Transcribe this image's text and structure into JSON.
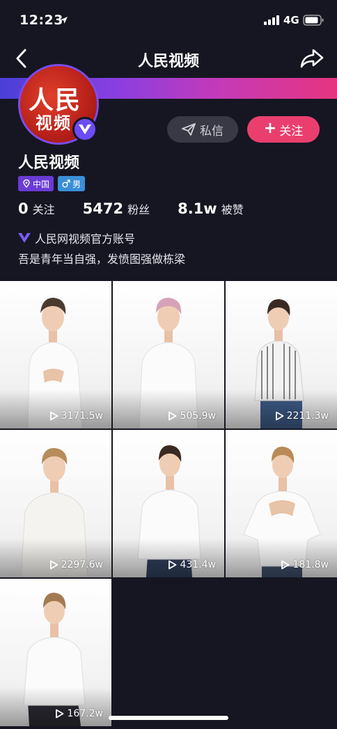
{
  "status_bar": {
    "time": "12:23",
    "network": "4G"
  },
  "nav": {
    "title": "人民视频",
    "back_icon": "chevron-left-icon",
    "share_icon": "share-arrow-icon"
  },
  "profile": {
    "avatar_text_line1": "人民",
    "avatar_text_line2": "视频",
    "name": "人民视频",
    "tags": [
      {
        "label": "中国",
        "icon": "location-pin-icon"
      },
      {
        "label": "男",
        "icon": "male-icon"
      }
    ],
    "stats": [
      {
        "value": "0",
        "label": "关注"
      },
      {
        "value": "5472",
        "label": "粉丝"
      },
      {
        "value": "8.1w",
        "label": "被赞"
      }
    ],
    "verified_text": "人民网视频官方账号",
    "bio": "吾是青年当自强，发愤图强做栋梁"
  },
  "actions": {
    "message_label": "私信",
    "follow_label": "关注"
  },
  "videos": [
    {
      "plays": "3171.5w"
    },
    {
      "plays": "505.9w"
    },
    {
      "plays": "2211.3w"
    },
    {
      "plays": "2297.6w"
    },
    {
      "plays": "431.4w"
    },
    {
      "plays": "181.8w"
    },
    {
      "plays": "167.2w"
    }
  ],
  "colors": {
    "background": "#161622",
    "follow": "#ea3f6e",
    "message": "#393945",
    "accent_purple": "#6c4cf4"
  }
}
